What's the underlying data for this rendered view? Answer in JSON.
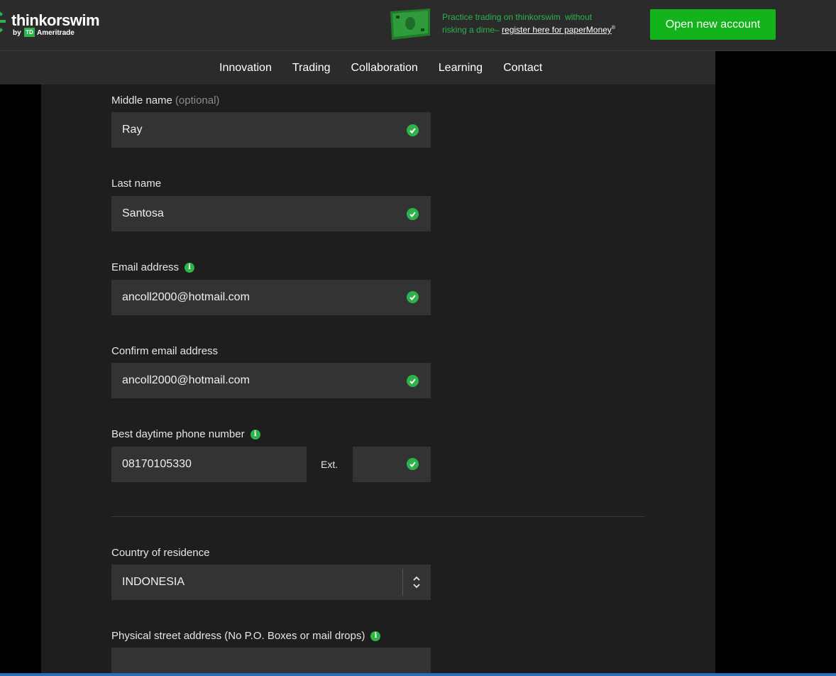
{
  "header": {
    "logo": {
      "name": "thinkorswim",
      "by": "by",
      "td": "TD",
      "company": "Ameritrade"
    },
    "promo": {
      "line1": "Practice trading on thinkorswim",
      "line2a": "without",
      "line2b": "risking a dime–",
      "link": "register here for paperMoney",
      "reg": "®"
    },
    "cta": "Open new account"
  },
  "nav": {
    "items": [
      "Innovation",
      "Trading",
      "Collaboration",
      "Learning",
      "Contact"
    ]
  },
  "form": {
    "middle_name": {
      "label": "Middle name",
      "optional": "(optional)",
      "value": "Ray"
    },
    "last_name": {
      "label": "Last name",
      "value": "Santosa"
    },
    "email": {
      "label": "Email address",
      "value": "ancoll2000@hotmail.com"
    },
    "confirm_email": {
      "label": "Confirm email address",
      "value": "ancoll2000@hotmail.com"
    },
    "phone": {
      "label": "Best daytime phone number",
      "value": "08170105330",
      "ext_label": "Ext.",
      "ext_value": ""
    },
    "country": {
      "label": "Country of residence",
      "value": "INDONESIA"
    },
    "street": {
      "label": "Physical street address (No P.O. Boxes or mail drops)",
      "value": ""
    }
  },
  "colors": {
    "accent": "#2db34a",
    "cta": "#12b31b",
    "panel": "#1e1e1e",
    "input": "#333333"
  }
}
